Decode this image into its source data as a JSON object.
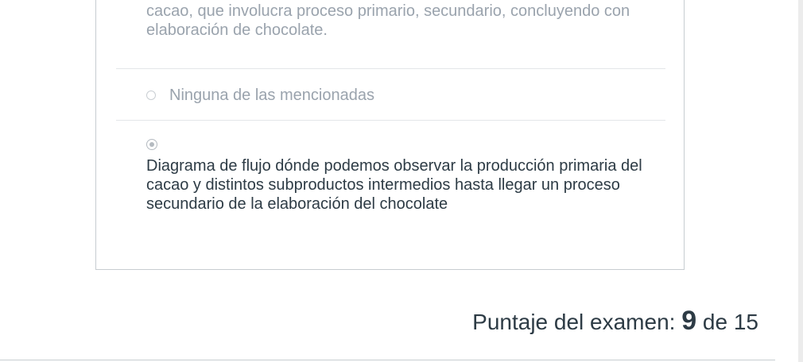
{
  "question": {
    "previous_answer_text": "cacao, que involucra proceso primario, secundario, concluyendo con elaboración de chocolate.",
    "answer_none": {
      "label": "Ninguna de las mencionadas",
      "selected": false
    },
    "answer_selected": {
      "label": "Diagrama de flujo dónde podemos observar la producción primaria del cacao y distintos subproductos intermedios hasta llegar un proceso secundario de la elaboración del chocolate",
      "selected": true
    }
  },
  "score": {
    "prefix": "Puntaje del examen:",
    "value": "9",
    "connector": "de",
    "total": "15"
  }
}
